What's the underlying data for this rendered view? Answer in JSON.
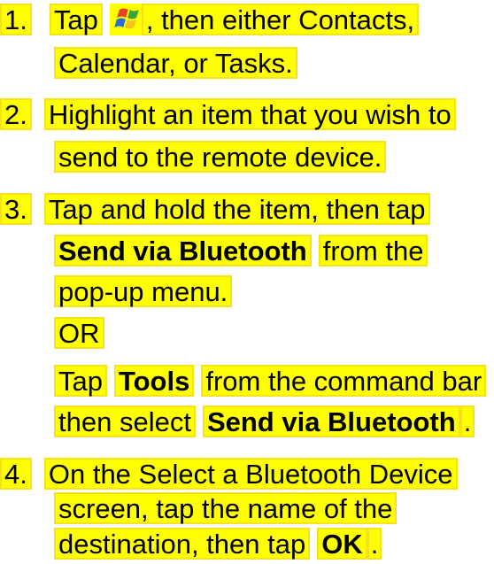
{
  "steps": [
    {
      "num": "1.",
      "line1_a": "Tap",
      "line1_b": ", then either Contacts,",
      "line2": "Calendar, or Tasks.",
      "icon": "windows-start-icon"
    },
    {
      "num": "2.",
      "line1": "Highlight an item that you wish to",
      "line2": "send to the remote device."
    },
    {
      "num": "3.",
      "line1": "Tap and hold the item, then tap",
      "line2_bold": "Send via Bluetooth",
      "line2_rest": "from the",
      "line3": "pop-up menu.",
      "or": "OR",
      "alt1_a": "Tap",
      "alt1_bold": "Tools",
      "alt1_rest": "from the command bar",
      "alt2_a": "then select",
      "alt2_bold": "Send via Bluetooth",
      "alt2_end": "."
    },
    {
      "num": "4.",
      "line1": "On the Select a Bluetooth Device",
      "line2": "screen, tap the name of the",
      "line3_a": "destination, then tap",
      "line3_bold": "OK",
      "line3_end": "."
    }
  ],
  "colors": {
    "highlight": "#ffff00",
    "highlight_border": "#f5e21a"
  }
}
